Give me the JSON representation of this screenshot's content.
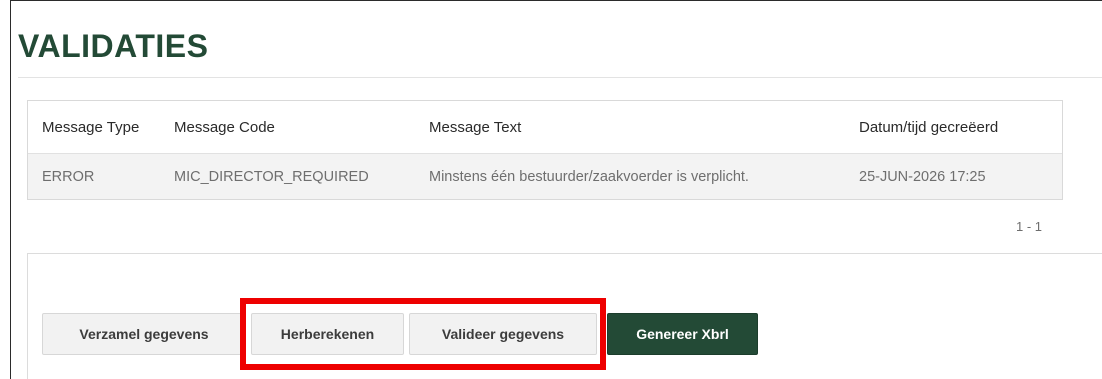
{
  "page": {
    "title": "VALIDATIES"
  },
  "messages": {
    "headers": [
      "Message Type",
      "Message Code",
      "Message Text",
      "Datum/tijd gecreëerd"
    ],
    "rows": [
      {
        "type": "ERROR",
        "code": "MIC_DIRECTOR_REQUIRED",
        "text": "Minstens één bestuurder/zaakvoerder is verplicht.",
        "created": "25-JUN-2026 17:25"
      }
    ],
    "pagination": "1 - 1"
  },
  "actions": {
    "collect_label": "Verzamel gegevens",
    "recalculate_label": "Herberekenen",
    "validate_label": "Valideer gegevens",
    "generate_label": "Genereer Xbrl"
  },
  "colors": {
    "brand_green": "#234a36",
    "highlight_red": "#ee0000"
  }
}
